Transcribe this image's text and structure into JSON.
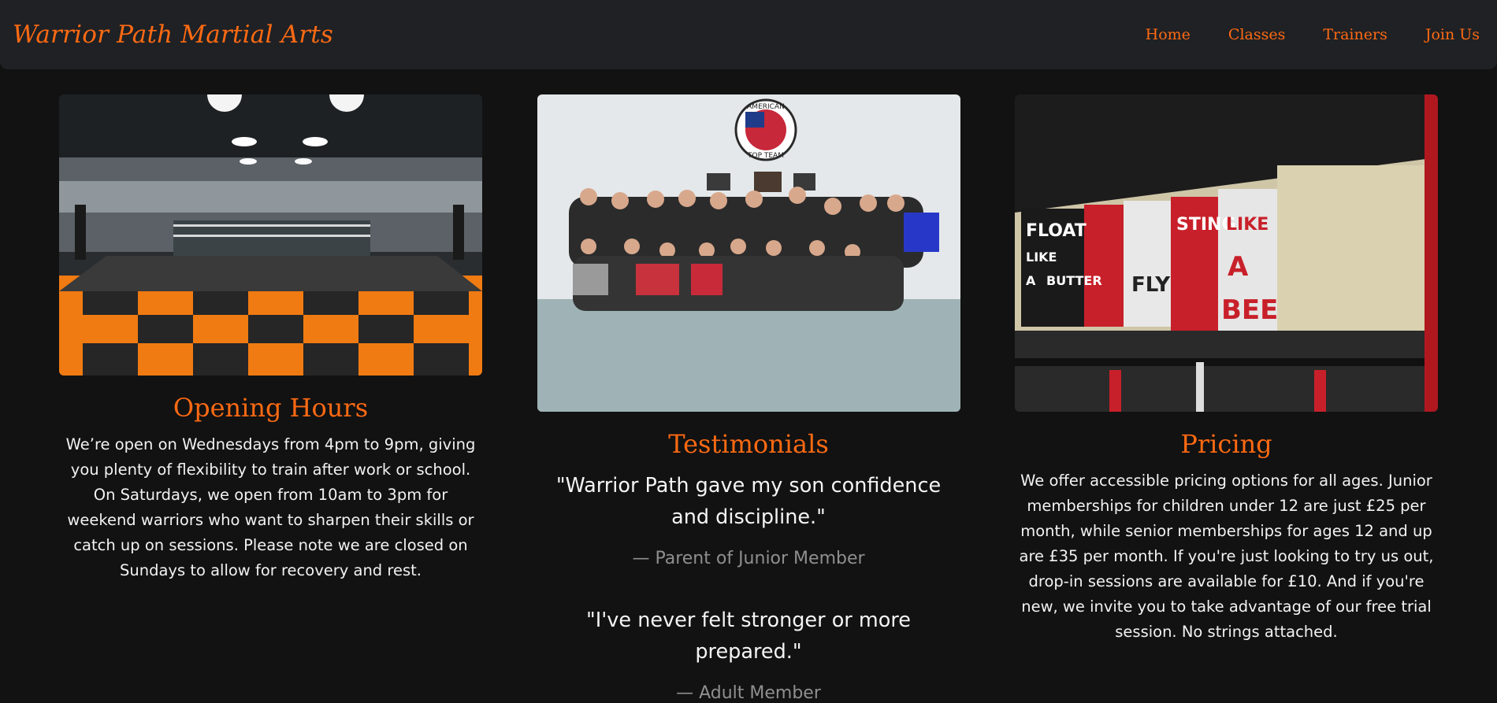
{
  "nav": {
    "brand": "Warrior Path Martial Arts",
    "links": [
      "Home",
      "Classes",
      "Trainers",
      "Join Us"
    ]
  },
  "sections": {
    "hours": {
      "image": "gym-interior-checkered-mat-photo",
      "title": "Opening Hours",
      "text": "We’re open on Wednesdays from 4pm to 9pm, giving you plenty of flexibility to train after work or school. On Saturdays, we open from 10am to 3pm for weekend warriors who want to sharpen their skills or catch up on sessions. Please note we are closed on Sundays to allow for recovery and rest."
    },
    "testimonials": {
      "image": "team-group-photo",
      "logo_text": "AMERICAN TOP TEAM",
      "title": "Testimonials",
      "items": [
        {
          "quote": "\"Warrior Path gave my son confidence and discipline.\"",
          "author": "— Parent of Junior Member"
        },
        {
          "quote": "\"I've never felt stronger or more prepared.\"",
          "author": "— Adult Member"
        }
      ]
    },
    "pricing": {
      "image": "gym-mural-photo",
      "mural_words": [
        "FLOAT",
        "LIKE",
        "A",
        "BUTTER",
        "FLY",
        "STING",
        "LIKE",
        "A",
        "BEE"
      ],
      "title": "Pricing",
      "text": "We offer accessible pricing options for all ages. Junior memberships for children under 12 are just £25 per month, while senior memberships for ages 12 and up are £35 per month. If you're just looking to try us out, drop-in sessions are available for £10. And if you're new, we invite you to take advantage of our free trial session. No strings attached."
    }
  },
  "colors": {
    "accent": "#ff6a13",
    "background": "#121212",
    "navbar": "#1f2124"
  }
}
